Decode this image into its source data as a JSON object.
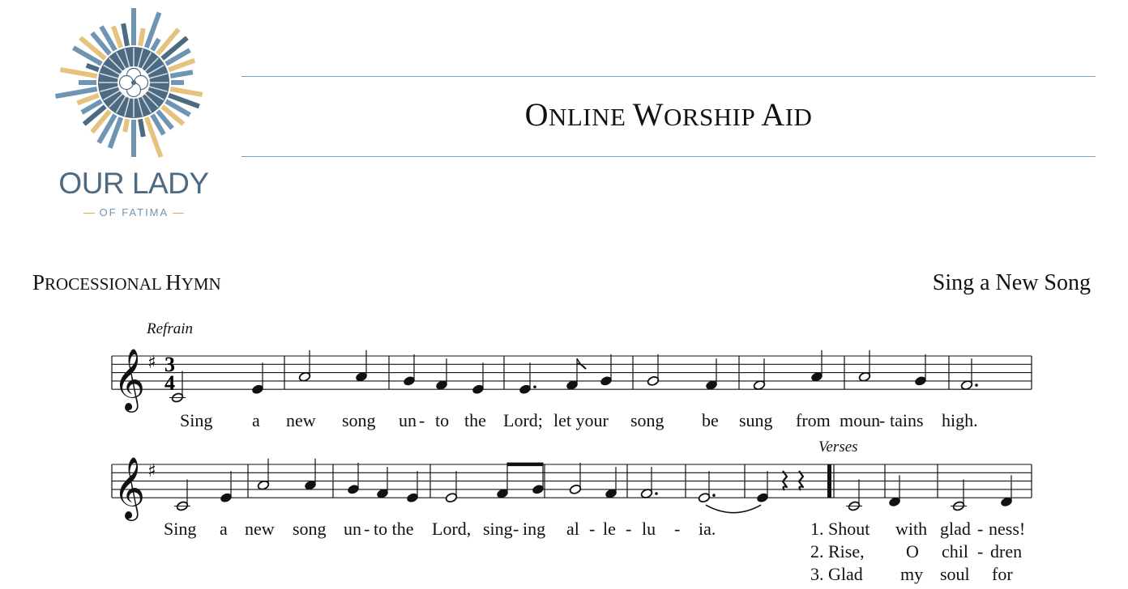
{
  "logo": {
    "line1": "OUR LADY",
    "line2": "OF FATIMA",
    "colors": {
      "blue": "#6f95b4",
      "slate": "#4d6a83",
      "gold": "#e6c27f"
    }
  },
  "header": {
    "title_parts": [
      "O",
      "NLINE ",
      "W",
      "ORSHIP ",
      "A",
      "ID"
    ],
    "rule_color": "#7aa6c6"
  },
  "section": {
    "label_parts": [
      "P",
      "ROCESSIONAL ",
      "H",
      "YMN"
    ],
    "hymn_title": "Sing a New Song"
  },
  "music": {
    "system1": {
      "marking": "Refrain",
      "time_top": "3",
      "time_bottom": "4",
      "lyrics": [
        "Sing",
        "a",
        "new",
        "song",
        "un",
        "-",
        "to",
        "the",
        "Lord;",
        "let your",
        "song",
        "be",
        "sung",
        "from",
        "moun",
        "-",
        "tains",
        "high."
      ]
    },
    "system2": {
      "marking": "Verses",
      "lyrics": [
        "Sing",
        "a",
        "new",
        "song",
        "un",
        "-",
        "to the",
        "Lord,",
        "sing",
        "-",
        "ing",
        "al",
        "-",
        "le",
        "-",
        "lu",
        "-",
        "ia."
      ],
      "verses": [
        [
          "1. Shout",
          "with",
          "glad",
          "-",
          "ness!"
        ],
        [
          "2. Rise,",
          "O",
          "chil",
          "-",
          "dren"
        ],
        [
          "3. Glad",
          "my",
          "soul",
          "for"
        ]
      ]
    }
  }
}
